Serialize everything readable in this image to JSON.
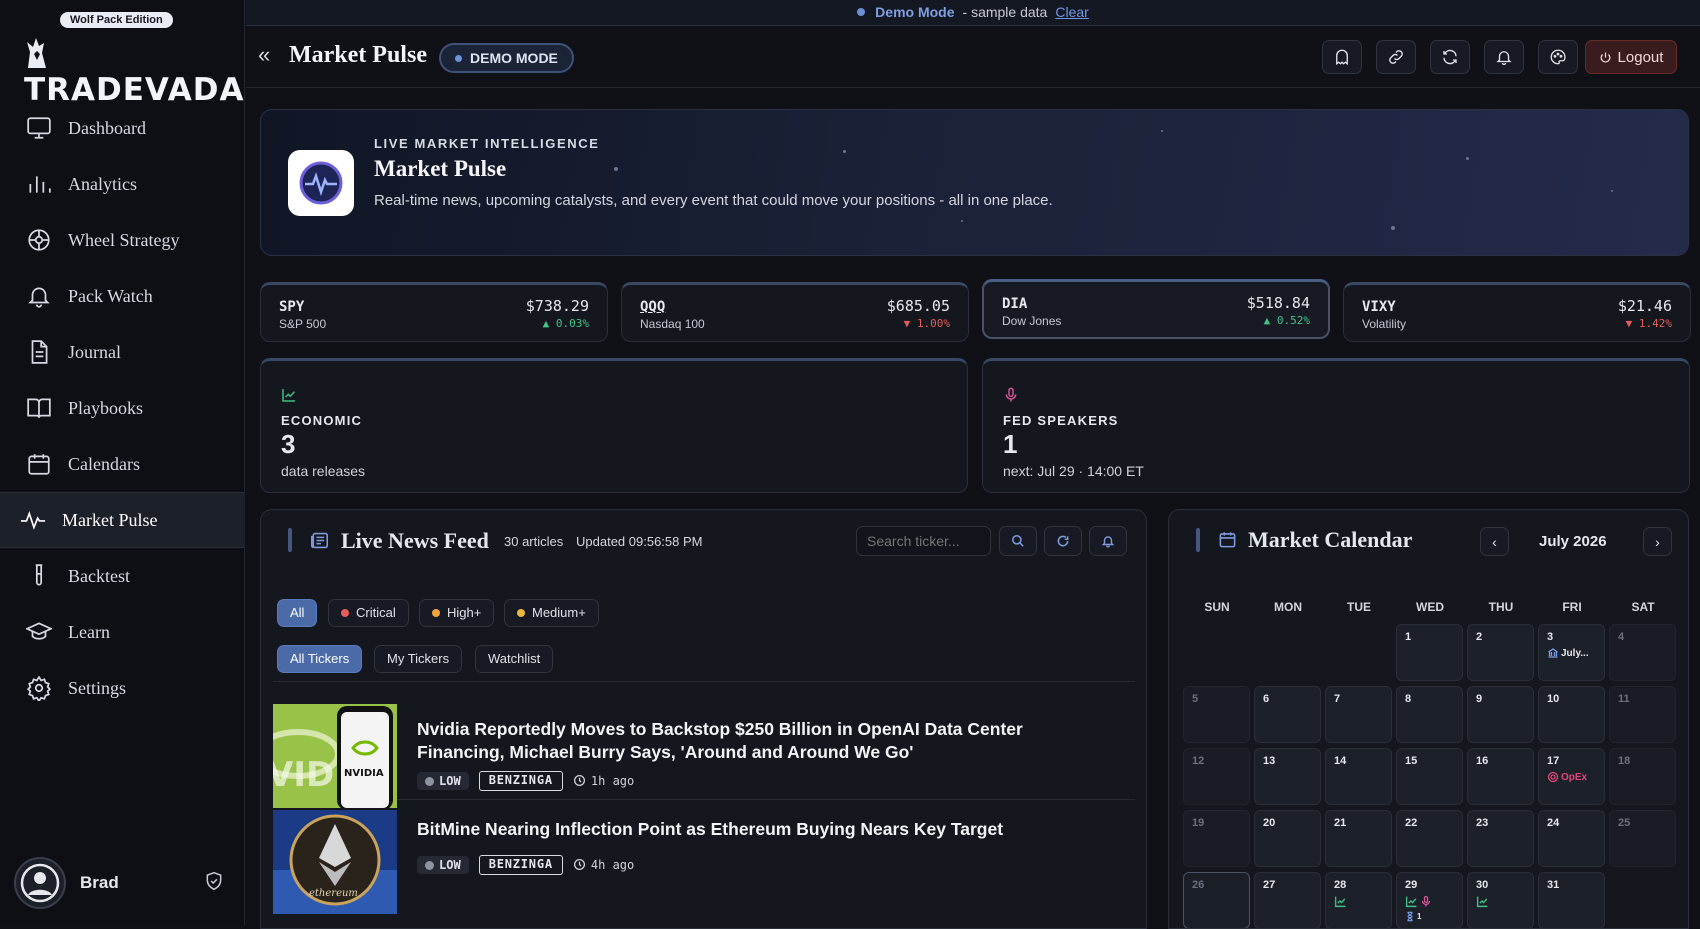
{
  "banner": {
    "mode": "Demo Mode",
    "text": "- sample data",
    "clear": "Clear"
  },
  "sidebar": {
    "edition": "Wolf Pack Edition",
    "brand": "TRADEVADA",
    "items": [
      {
        "label": "Dashboard",
        "icon": "monitor-icon"
      },
      {
        "label": "Analytics",
        "icon": "bar-chart-icon"
      },
      {
        "label": "Wheel Strategy",
        "icon": "wheel-icon"
      },
      {
        "label": "Pack Watch",
        "icon": "bell-icon"
      },
      {
        "label": "Journal",
        "icon": "document-icon"
      },
      {
        "label": "Playbooks",
        "icon": "book-icon"
      },
      {
        "label": "Calendars",
        "icon": "calendar-icon"
      },
      {
        "label": "Market Pulse",
        "icon": "pulse-icon",
        "active": true
      },
      {
        "label": "Backtest",
        "icon": "test-tube-icon"
      },
      {
        "label": "Learn",
        "icon": "graduation-cap-icon"
      },
      {
        "label": "Settings",
        "icon": "gear-icon"
      }
    ],
    "user": {
      "name": "Brad"
    }
  },
  "header": {
    "title": "Market Pulse",
    "badge": "DEMO MODE",
    "logout": "Logout"
  },
  "hero": {
    "kicker": "LIVE MARKET INTELLIGENCE",
    "title": "Market Pulse",
    "description": "Real-time news, upcoming catalysts, and every event that could move your positions - all in one place."
  },
  "indices": [
    {
      "symbol": "SPY",
      "name": "S&P 500",
      "price": "$738.29",
      "change": "▲ 0.03%",
      "direction": "up"
    },
    {
      "symbol": "QQQ",
      "name": "Nasdaq 100",
      "price": "$685.05",
      "change": "▼ 1.00%",
      "direction": "down"
    },
    {
      "symbol": "DIA",
      "name": "Dow Jones",
      "price": "$518.84",
      "change": "▲ 0.52%",
      "direction": "up"
    },
    {
      "symbol": "VIXY",
      "name": "Volatility",
      "price": "$21.46",
      "change": "▼ 1.42%",
      "direction": "down"
    }
  ],
  "stats": [
    {
      "label": "ECONOMIC",
      "value": "3",
      "sub": "data releases",
      "icon": "trend-chart-icon"
    },
    {
      "label": "FED SPEAKERS",
      "value": "1",
      "sub": "next: Jul 29 · 14:00 ET",
      "icon": "microphone-icon"
    }
  ],
  "news": {
    "title": "Live News Feed",
    "count": "30 articles",
    "updated": "Updated 09:56:58 PM",
    "search_placeholder": "Search ticker...",
    "severity_filters": [
      "All",
      "Critical",
      "High+",
      "Medium+"
    ],
    "ticker_filters": [
      "All Tickers",
      "My Tickers",
      "Watchlist"
    ],
    "articles": [
      {
        "title": "Nvidia Reportedly Moves to Backstop $250 Billion in OpenAI Data Center Financing, Michael Burry Says, 'Around and Around We Go'",
        "impact": "LOW",
        "source": "BENZINGA",
        "time": "1h ago",
        "thumb_text": "NVIDIA"
      },
      {
        "title": "BitMine Nearing Inflection Point as Ethereum Buying Nears Key Target",
        "impact": "LOW",
        "source": "BENZINGA",
        "time": "4h ago",
        "thumb_text": "ethereum"
      }
    ]
  },
  "calendar": {
    "title": "Market Calendar",
    "month": "July 2026",
    "weekdays": [
      "SUN",
      "MON",
      "TUE",
      "WED",
      "THU",
      "FRI",
      "SAT"
    ],
    "events": {
      "jul3": "July...",
      "jul17": "OpEx",
      "jul29_count": "1"
    },
    "colors": {
      "econ": "#3fbf86",
      "fed": "#d9569b",
      "opex": "#e2467a",
      "holiday": "#7ea3f0"
    }
  }
}
